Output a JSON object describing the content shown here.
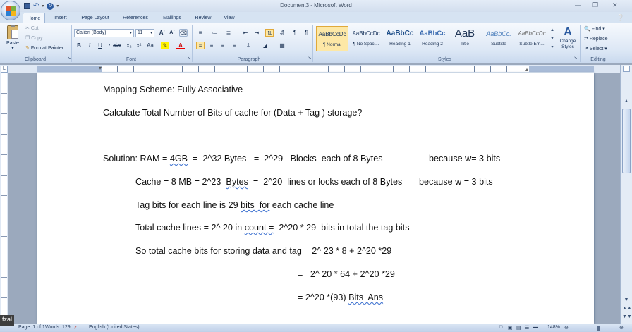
{
  "window": {
    "title": "Document3 - Microsoft Word"
  },
  "qat": {
    "save_icon": "save-icon",
    "undo_icon": "undo-icon",
    "redo_icon": "redo-icon"
  },
  "tabs": [
    {
      "label": "Home",
      "active": true
    },
    {
      "label": "Insert"
    },
    {
      "label": "Page Layout"
    },
    {
      "label": "References"
    },
    {
      "label": "Mailings"
    },
    {
      "label": "Review"
    },
    {
      "label": "View"
    }
  ],
  "ribbon": {
    "clipboard": {
      "paste": "Paste",
      "cut": "Cut",
      "copy": "Copy",
      "format_painter": "Format Painter",
      "label": "Clipboard"
    },
    "font": {
      "name": "Calibri (Body)",
      "size": "11",
      "label": "Font"
    },
    "paragraph": {
      "label": "Paragraph"
    },
    "styles": {
      "label": "Styles",
      "items": [
        {
          "preview": "AaBbCcDc",
          "name": "¶ Normal"
        },
        {
          "preview": "AaBbCcDc",
          "name": "¶ No Spaci..."
        },
        {
          "preview": "AaBbCc",
          "name": "Heading 1"
        },
        {
          "preview": "AaBbCc",
          "name": "Heading 2"
        },
        {
          "preview": "AaB",
          "name": "Title"
        },
        {
          "preview": "AaBbCc.",
          "name": "Subtitle"
        },
        {
          "preview": "AaBbCcDc",
          "name": "Subtle Em..."
        }
      ],
      "change_styles": "Change Styles"
    },
    "editing": {
      "find": "Find",
      "replace": "Replace",
      "select": "Select",
      "label": "Editing"
    }
  },
  "document": {
    "mapping_scheme": "Mapping Scheme: Fully Associative",
    "question": "Calculate Total Number of Bits of cache for (Data + Tag ) storage?",
    "sol_prefix": "Solution: RAM = ",
    "sol_4gb": "4GB",
    "sol_rest": "  =  2^32 Bytes   =  2^29   Blocks  each of 8 Bytes",
    "sol_because": "because w= 3 bits",
    "cache_prefix": "Cache = 8 MB = 2^23  ",
    "cache_bytes": "Bytes",
    "cache_rest": "  =  2^20  lines or locks each of 8 Bytes",
    "cache_because": "because w = 3 bits",
    "tag_prefix": "Tag bits for each line is 29 ",
    "tag_bits": "bits  for",
    "tag_rest": " each cache line",
    "total_prefix": "Total cache lines = 2^ 20 in ",
    "total_count": "count =",
    "total_rest": "  2^20 * 29  bits in total the tag bits",
    "so_total": "So total cache bits for storing data and tag = 2^ 23 * 8 + 2^20 *29",
    "eq1": "=   2^ 20 * 64 + 2^20 *29",
    "eq2_prefix": "= 2^20 *(93) ",
    "eq2_bits": "Bits  Ans"
  },
  "status": {
    "page": "Page: 1 of 1",
    "words": "Words: 129",
    "language": "English (United States)",
    "zoom": "148%"
  },
  "user_tag": "fzal"
}
